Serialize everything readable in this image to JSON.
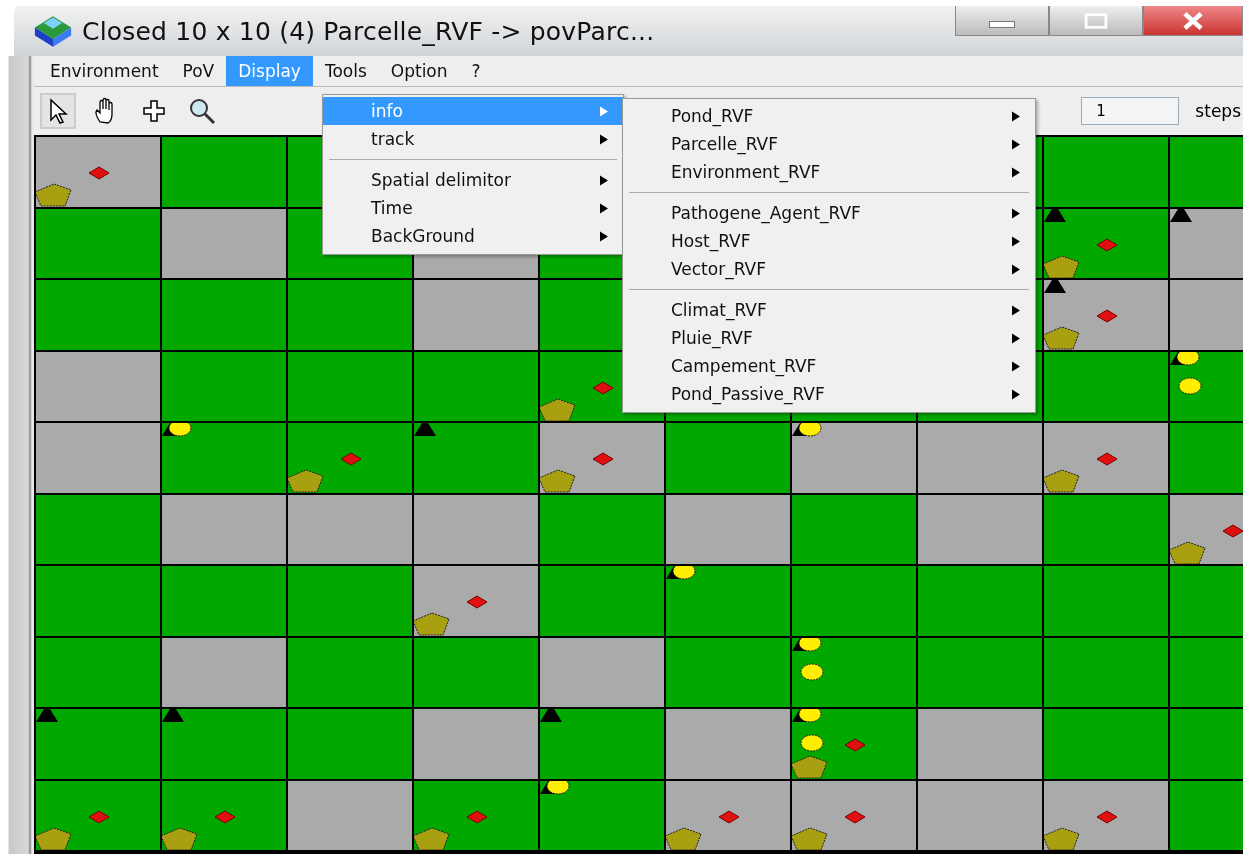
{
  "window": {
    "title": "Closed 10 x 10 (4)  Parcelle_RVF -> povParc..."
  },
  "menu_bar": [
    {
      "label": "Environment",
      "selected": false
    },
    {
      "label": "PoV",
      "selected": false
    },
    {
      "label": "Display",
      "selected": true
    },
    {
      "label": "Tools",
      "selected": false
    },
    {
      "label": "Option",
      "selected": false
    },
    {
      "label": "?",
      "selected": false
    }
  ],
  "toolbar": {
    "tools": [
      {
        "kind": "pointer",
        "selected": true
      },
      {
        "kind": "hand",
        "selected": false
      },
      {
        "kind": "cross",
        "selected": false
      },
      {
        "kind": "zoom",
        "selected": false
      }
    ],
    "steps_field": {
      "value": "1"
    },
    "steps_label": "steps"
  },
  "display_menu": [
    {
      "kind": "item",
      "label": "info",
      "selected": true,
      "submenu": true
    },
    {
      "kind": "item",
      "label": "track",
      "selected": false,
      "submenu": true
    },
    {
      "kind": "separator"
    },
    {
      "kind": "item",
      "label": "Spatial delimitor",
      "selected": false,
      "submenu": true
    },
    {
      "kind": "item",
      "label": "Time",
      "selected": false,
      "submenu": true
    },
    {
      "kind": "item",
      "label": "BackGround",
      "selected": false,
      "submenu": true
    }
  ],
  "info_submenu": [
    {
      "kind": "item",
      "label": "Pond_RVF",
      "selected": false,
      "submenu": true
    },
    {
      "kind": "item",
      "label": "Parcelle_RVF",
      "selected": false,
      "submenu": true
    },
    {
      "kind": "item",
      "label": "Environment_RVF",
      "selected": false,
      "submenu": true
    },
    {
      "kind": "separator"
    },
    {
      "kind": "item",
      "label": "Pathogene_Agent_RVF",
      "selected": false,
      "submenu": true
    },
    {
      "kind": "item",
      "label": "Host_RVF",
      "selected": false,
      "submenu": true
    },
    {
      "kind": "item",
      "label": "Vector_RVF",
      "selected": false,
      "submenu": true
    },
    {
      "kind": "separator"
    },
    {
      "kind": "item",
      "label": "Climat_RVF",
      "selected": false,
      "submenu": true
    },
    {
      "kind": "item",
      "label": "Pluie_RVF",
      "selected": false,
      "submenu": true
    },
    {
      "kind": "item",
      "label": "Campement_RVF",
      "selected": false,
      "submenu": true
    },
    {
      "kind": "item",
      "label": "Pond_Passive_RVF",
      "selected": false,
      "submenu": true
    }
  ],
  "grid": {
    "rows": [
      [
        {
          "color": "#aaaaaa",
          "agents": [
            {
              "kind": "diamond"
            },
            {
              "kind": "pentagon"
            }
          ]
        },
        {
          "color": "#00a800"
        },
        {
          "color": "#00a800"
        },
        null,
        null,
        null,
        null,
        null,
        {
          "color": "#00a800"
        },
        {
          "color": "#00a800"
        }
      ],
      [
        {
          "color": "#00a800"
        },
        {
          "color": "#aaaaaa"
        },
        {
          "color": "#00a800"
        },
        {
          "color": "#aaaaaa"
        },
        {
          "color": "#00a800"
        },
        null,
        null,
        null,
        {
          "color": "#00a800",
          "agents": [
            {
              "kind": "triangle"
            },
            {
              "kind": "diamond"
            },
            {
              "kind": "pentagon"
            }
          ]
        },
        {
          "color": "#aaaaaa",
          "agents": [
            {
              "kind": "triangle"
            }
          ]
        }
      ],
      [
        {
          "color": "#00a800"
        },
        {
          "color": "#00a800"
        },
        {
          "color": "#00a800"
        },
        {
          "color": "#aaaaaa"
        },
        {
          "color": "#00a800"
        },
        null,
        null,
        null,
        {
          "color": "#aaaaaa",
          "agents": [
            {
              "kind": "triangle"
            },
            {
              "kind": "diamond"
            },
            {
              "kind": "pentagon"
            }
          ]
        },
        {
          "color": "#aaaaaa"
        }
      ],
      [
        {
          "color": "#aaaaaa"
        },
        {
          "color": "#00a800"
        },
        {
          "color": "#00a800"
        },
        {
          "color": "#00a800"
        },
        {
          "color": "#00a800",
          "agents": [
            {
              "kind": "diamond"
            },
            {
              "kind": "pentagon"
            }
          ]
        },
        {
          "color": "#00a800"
        },
        {
          "color": "#00a800"
        },
        {
          "color": "#00a800"
        },
        {
          "color": "#00a800"
        },
        {
          "color": "#00a800",
          "agents": [
            {
              "kind": "triangle"
            },
            {
              "kind": "circle"
            },
            {
              "kind": "circle"
            }
          ]
        }
      ],
      [
        {
          "color": "#aaaaaa"
        },
        {
          "color": "#00a800",
          "agents": [
            {
              "kind": "triangle"
            },
            {
              "kind": "circle"
            }
          ]
        },
        {
          "color": "#00a800",
          "agents": [
            {
              "kind": "diamond"
            },
            {
              "kind": "pentagon"
            }
          ]
        },
        {
          "color": "#00a800",
          "agents": [
            {
              "kind": "triangle"
            }
          ]
        },
        {
          "color": "#aaaaaa",
          "agents": [
            {
              "kind": "diamond"
            },
            {
              "kind": "pentagon"
            }
          ]
        },
        {
          "color": "#00a800"
        },
        {
          "color": "#aaaaaa",
          "agents": [
            {
              "kind": "triangle"
            },
            {
              "kind": "circle"
            }
          ]
        },
        {
          "color": "#aaaaaa"
        },
        {
          "color": "#aaaaaa",
          "agents": [
            {
              "kind": "diamond"
            },
            {
              "kind": "pentagon"
            }
          ]
        },
        {
          "color": "#00a800"
        }
      ],
      [
        {
          "color": "#00a800"
        },
        {
          "color": "#aaaaaa"
        },
        {
          "color": "#aaaaaa"
        },
        {
          "color": "#aaaaaa"
        },
        {
          "color": "#00a800"
        },
        {
          "color": "#aaaaaa"
        },
        {
          "color": "#00a800"
        },
        {
          "color": "#aaaaaa"
        },
        {
          "color": "#00a800"
        },
        {
          "color": "#aaaaaa",
          "agents": [
            {
              "kind": "diamond"
            },
            {
              "kind": "pentagon"
            }
          ]
        }
      ],
      [
        {
          "color": "#00a800"
        },
        {
          "color": "#00a800"
        },
        {
          "color": "#00a800"
        },
        {
          "color": "#aaaaaa",
          "agents": [
            {
              "kind": "diamond"
            },
            {
              "kind": "pentagon"
            }
          ]
        },
        {
          "color": "#00a800"
        },
        {
          "color": "#00a800",
          "agents": [
            {
              "kind": "triangle"
            },
            {
              "kind": "circle"
            }
          ]
        },
        {
          "color": "#00a800"
        },
        {
          "color": "#00a800"
        },
        {
          "color": "#00a800"
        },
        {
          "color": "#00a800"
        }
      ],
      [
        {
          "color": "#00a800"
        },
        {
          "color": "#aaaaaa"
        },
        {
          "color": "#00a800"
        },
        {
          "color": "#00a800"
        },
        {
          "color": "#aaaaaa"
        },
        {
          "color": "#00a800"
        },
        {
          "color": "#00a800",
          "agents": [
            {
              "kind": "triangle"
            },
            {
              "kind": "circle"
            },
            {
              "kind": "circle"
            }
          ]
        },
        {
          "color": "#00a800"
        },
        {
          "color": "#00a800"
        },
        {
          "color": "#00a800"
        }
      ],
      [
        {
          "color": "#00a800",
          "agents": [
            {
              "kind": "triangle"
            }
          ]
        },
        {
          "color": "#00a800",
          "agents": [
            {
              "kind": "triangle"
            }
          ]
        },
        {
          "color": "#00a800"
        },
        {
          "color": "#aaaaaa"
        },
        {
          "color": "#00a800",
          "agents": [
            {
              "kind": "triangle"
            }
          ]
        },
        {
          "color": "#aaaaaa"
        },
        {
          "color": "#00a800",
          "agents": [
            {
              "kind": "triangle"
            },
            {
              "kind": "circle"
            },
            {
              "kind": "diamond"
            },
            {
              "kind": "circle"
            },
            {
              "kind": "pentagon"
            }
          ]
        },
        {
          "color": "#aaaaaa"
        },
        {
          "color": "#00a800"
        },
        {
          "color": "#00a800"
        }
      ],
      [
        {
          "color": "#00a800",
          "agents": [
            {
              "kind": "diamond"
            },
            {
              "kind": "pentagon"
            }
          ]
        },
        {
          "color": "#00a800",
          "agents": [
            {
              "kind": "diamond"
            },
            {
              "kind": "pentagon"
            }
          ]
        },
        {
          "color": "#aaaaaa"
        },
        {
          "color": "#00a800",
          "agents": [
            {
              "kind": "diamond"
            },
            {
              "kind": "pentagon"
            }
          ]
        },
        {
          "color": "#00a800",
          "agents": [
            {
              "kind": "triangle"
            },
            {
              "kind": "circle"
            }
          ]
        },
        {
          "color": "#aaaaaa",
          "agents": [
            {
              "kind": "diamond"
            },
            {
              "kind": "pentagon"
            }
          ]
        },
        {
          "color": "#aaaaaa",
          "agents": [
            {
              "kind": "diamond"
            },
            {
              "kind": "pentagon"
            }
          ]
        },
        {
          "color": "#aaaaaa"
        },
        {
          "color": "#aaaaaa",
          "agents": [
            {
              "kind": "diamond"
            },
            {
              "kind": "pentagon"
            }
          ]
        },
        {
          "color": "#00a800"
        }
      ]
    ]
  }
}
